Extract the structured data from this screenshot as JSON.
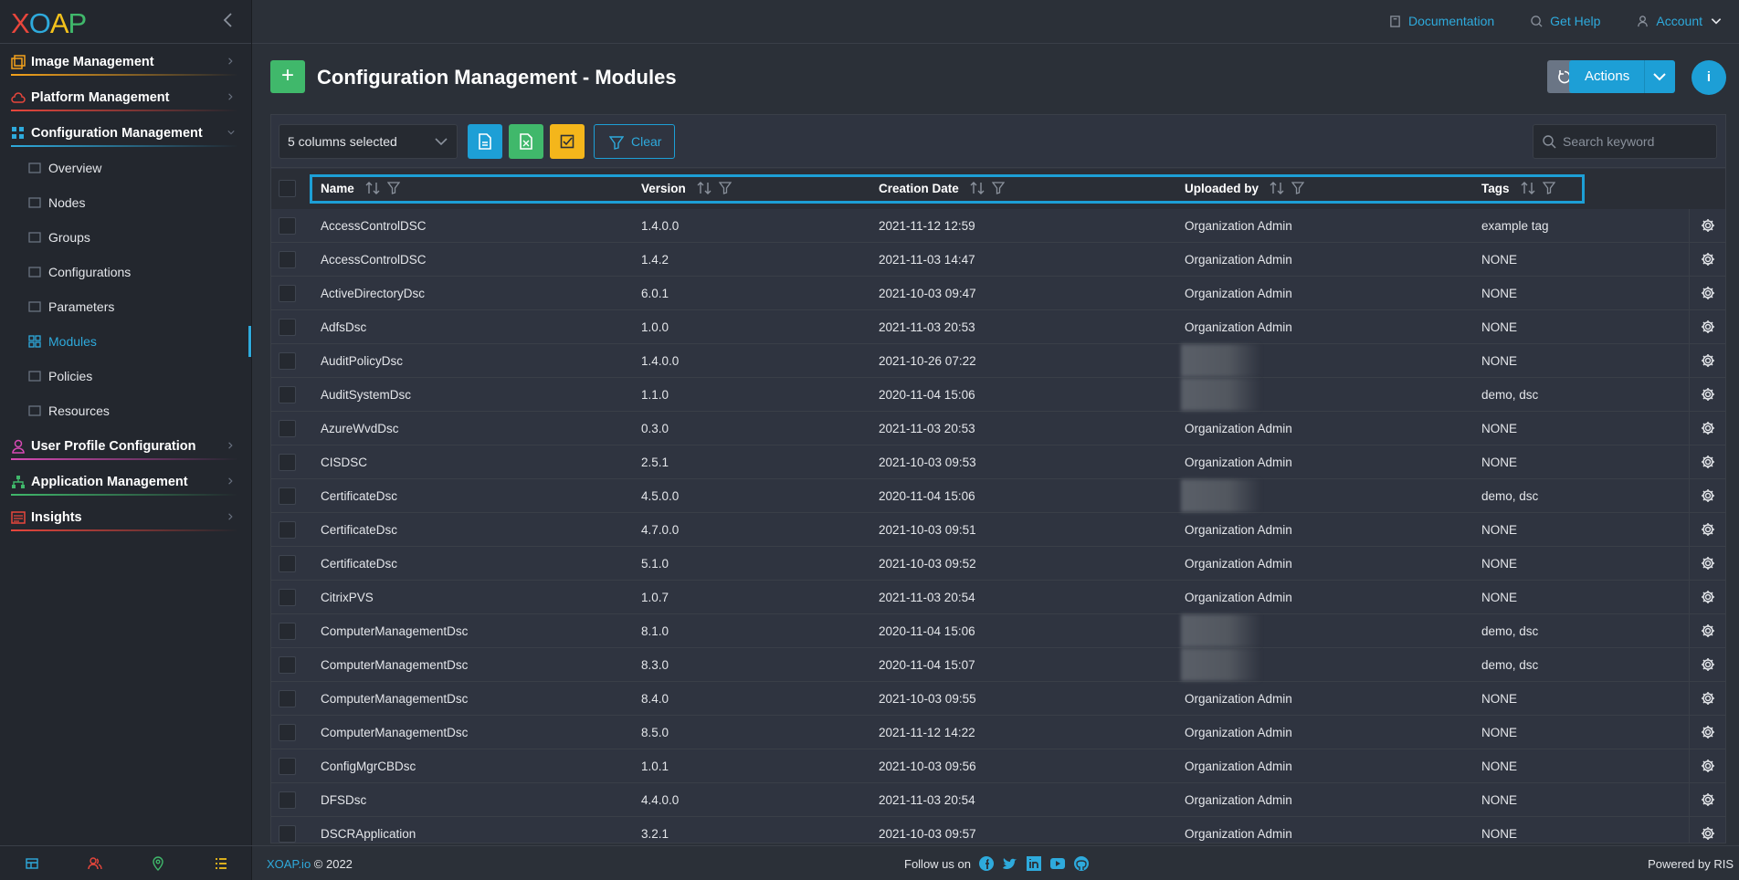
{
  "brand": {
    "logo_letters": [
      "X",
      "O",
      "A",
      "P"
    ],
    "logo_colors": [
      "#e8463c",
      "#2eaadc",
      "#f4c21b",
      "#40b86b"
    ]
  },
  "sidebar": {
    "sections": [
      {
        "label": "Image Management",
        "icon": "image-stack-icon",
        "color": "#f4a21b"
      },
      {
        "label": "Platform Management",
        "icon": "cloud-icon",
        "color": "#e8463c"
      },
      {
        "label": "Configuration Management",
        "icon": "config-grid-icon",
        "color": "#2eaadc"
      }
    ],
    "subitems": [
      {
        "label": "Overview",
        "icon": "overview-icon"
      },
      {
        "label": "Nodes",
        "icon": "monitor-icon"
      },
      {
        "label": "Groups",
        "icon": "group-icon"
      },
      {
        "label": "Configurations",
        "icon": "gear-icon"
      },
      {
        "label": "Parameters",
        "icon": "list-icon"
      },
      {
        "label": "Modules",
        "icon": "modules-icon",
        "active": true
      },
      {
        "label": "Policies",
        "icon": "policy-icon"
      },
      {
        "label": "Resources",
        "icon": "file-icon"
      }
    ],
    "sections_bottom": [
      {
        "label": "User Profile Configuration",
        "icon": "user-icon",
        "color": "#d84ab5"
      },
      {
        "label": "Application Management",
        "icon": "app-tree-icon",
        "color": "#40b86b"
      },
      {
        "label": "Insights",
        "icon": "insights-icon",
        "color": "#e8463c"
      }
    ],
    "footer_icons": [
      "dashboard-icon",
      "users-icon",
      "location-icon",
      "tasks-icon"
    ]
  },
  "topbar": {
    "documentation": "Documentation",
    "help": "Get Help",
    "account": "Account"
  },
  "page": {
    "title": "Configuration Management - Modules",
    "add_label": "+",
    "actions_label": "Actions",
    "info_label": "i"
  },
  "toolbar": {
    "columns_selected": "5 columns selected",
    "clear_label": "Clear",
    "search_placeholder": "Search keyword"
  },
  "table": {
    "headers": [
      "Name",
      "Version",
      "Creation Date",
      "Uploaded by",
      "Tags"
    ],
    "rows": [
      [
        "AccessControlDSC",
        "1.4.0.0",
        "2021-11-12 12:59",
        "Organization Admin",
        "example tag"
      ],
      [
        "AccessControlDSC",
        "1.4.2",
        "2021-11-03 14:47",
        "Organization Admin",
        "NONE"
      ],
      [
        "ActiveDirectoryDsc",
        "6.0.1",
        "2021-10-03 09:47",
        "Organization Admin",
        "NONE"
      ],
      [
        "AdfsDsc",
        "1.0.0",
        "2021-11-03 20:53",
        "Organization Admin",
        "NONE"
      ],
      [
        "AuditPolicyDsc",
        "1.4.0.0",
        "2021-10-26 07:22",
        "",
        "NONE"
      ],
      [
        "AuditSystemDsc",
        "1.1.0",
        "2020-11-04 15:06",
        "",
        "demo, dsc"
      ],
      [
        "AzureWvdDsc",
        "0.3.0",
        "2021-11-03 20:53",
        "Organization Admin",
        "NONE"
      ],
      [
        "CISDSC",
        "2.5.1",
        "2021-10-03 09:53",
        "Organization Admin",
        "NONE"
      ],
      [
        "CertificateDsc",
        "4.5.0.0",
        "2020-11-04 15:06",
        "",
        "demo, dsc"
      ],
      [
        "CertificateDsc",
        "4.7.0.0",
        "2021-10-03 09:51",
        "Organization Admin",
        "NONE"
      ],
      [
        "CertificateDsc",
        "5.1.0",
        "2021-10-03 09:52",
        "Organization Admin",
        "NONE"
      ],
      [
        "CitrixPVS",
        "1.0.7",
        "2021-11-03 20:54",
        "Organization Admin",
        "NONE"
      ],
      [
        "ComputerManagementDsc",
        "8.1.0",
        "2020-11-04 15:06",
        "",
        "demo, dsc"
      ],
      [
        "ComputerManagementDsc",
        "8.3.0",
        "2020-11-04 15:07",
        "",
        "demo, dsc"
      ],
      [
        "ComputerManagementDsc",
        "8.4.0",
        "2021-10-03 09:55",
        "Organization Admin",
        "NONE"
      ],
      [
        "ComputerManagementDsc",
        "8.5.0",
        "2021-11-12 14:22",
        "Organization Admin",
        "NONE"
      ],
      [
        "ConfigMgrCBDsc",
        "1.0.1",
        "2021-10-03 09:56",
        "Organization Admin",
        "NONE"
      ],
      [
        "DFSDsc",
        "4.4.0.0",
        "2021-11-03 20:54",
        "Organization Admin",
        "NONE"
      ],
      [
        "DSCRApplication",
        "3.2.1",
        "2021-10-03 09:57",
        "Organization Admin",
        "NONE"
      ]
    ]
  },
  "footer": {
    "brand": "XOAP.io",
    "copyright": " © 2022",
    "follow": "Follow us on",
    "powered": "Powered by RIS",
    "social": [
      "facebook-icon",
      "twitter-icon",
      "linkedin-icon",
      "youtube-icon",
      "github-icon"
    ]
  }
}
